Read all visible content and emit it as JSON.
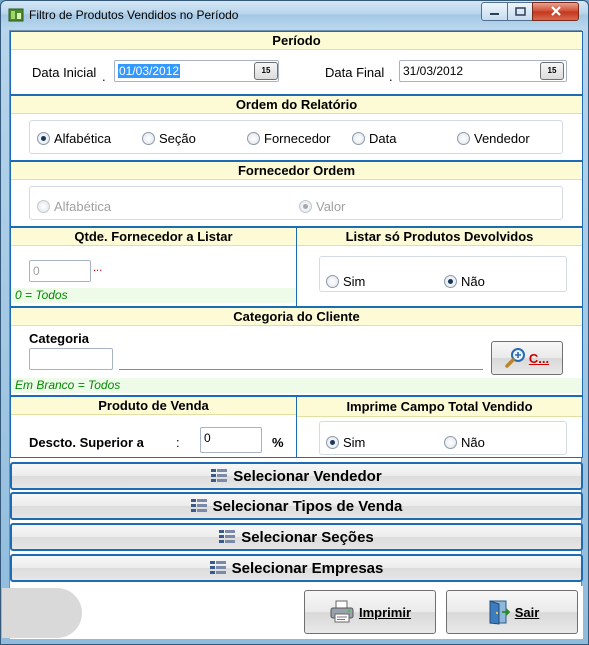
{
  "window": {
    "title": "Filtro de Produtos Vendidos no Período",
    "min_glyph": "–",
    "max_glyph": "□",
    "close_glyph": "✕"
  },
  "periodo": {
    "header": "Período",
    "data_inicial_label": "Data Inicial",
    "data_inicial_value": "01/03/2012",
    "data_final_label": "Data Final",
    "data_final_value": "31/03/2012",
    "calendar_glyph": "15",
    "label_dot": "."
  },
  "ordem": {
    "header": "Ordem do Relatório",
    "options": [
      "Alfabética",
      "Seção",
      "Fornecedor",
      "Data",
      "Vendedor"
    ],
    "selected": "Alfabética"
  },
  "fornecedor_ordem": {
    "header": "Fornecedor Ordem",
    "options": [
      "Alfabética",
      "Valor"
    ],
    "selected": "Valor"
  },
  "qtde": {
    "header": "Qtde. Fornecedor a Listar",
    "value": "0",
    "ellipsis": "...",
    "hint": "0 = Todos"
  },
  "devolvidos": {
    "header": "Listar só Produtos Devolvidos",
    "options": [
      "Sim",
      "Não"
    ],
    "selected": "Não"
  },
  "categoria": {
    "header": "Categoria do Cliente",
    "label": "Categoria",
    "value": "",
    "search_button": "C...",
    "hint": "Em Branco = Todos"
  },
  "produto": {
    "header": "Produto de Venda",
    "label": "Descto. Superior a",
    "colon": ":",
    "value": "0",
    "percent": "%"
  },
  "imprime": {
    "header": "Imprime Campo Total Vendido",
    "options": [
      "Sim",
      "Não"
    ],
    "selected": "Sim"
  },
  "buttons": {
    "vendedor": "Selecionar Vendedor",
    "tipos": "Selecionar Tipos de Venda",
    "secoes": "Selecionar Seções",
    "empresas": "Selecionar Empresas",
    "imprimir": "Imprimir",
    "sair": "Sair"
  },
  "colors": {
    "panel_border": "#1c6bb3",
    "header_bg": "#fdfbd5",
    "hint_green": "#008a00",
    "selection": "#3399ff"
  }
}
